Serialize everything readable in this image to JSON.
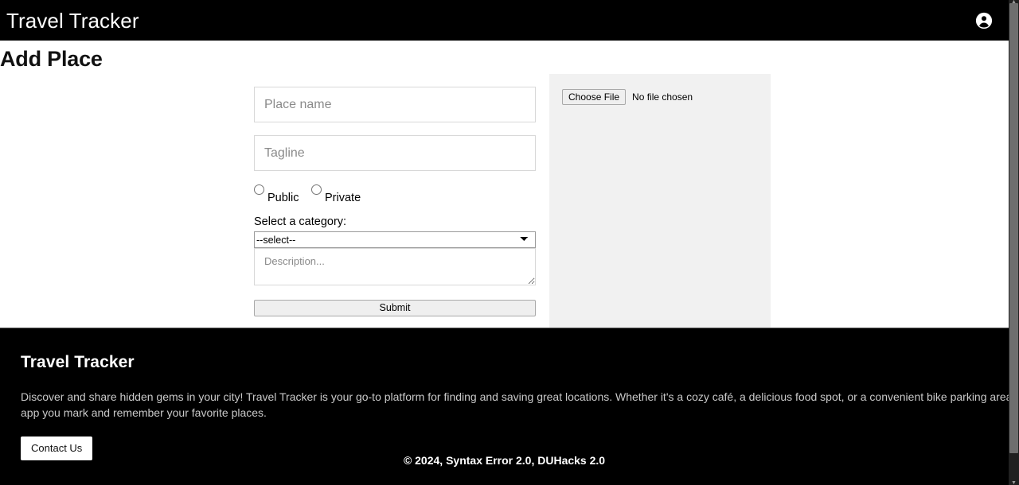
{
  "navbar": {
    "brand": "Travel Tracker",
    "account_icon": "account-circle-icon"
  },
  "page": {
    "title": "Add Place"
  },
  "form": {
    "place_name": {
      "placeholder": "Place name",
      "value": ""
    },
    "tagline": {
      "placeholder": "Tagline",
      "value": ""
    },
    "visibility": {
      "options": [
        {
          "label": "Public",
          "checked": false
        },
        {
          "label": "Private",
          "checked": false
        }
      ]
    },
    "category": {
      "label": "Select a category:",
      "selected": "--select--",
      "options": [
        "--select--"
      ]
    },
    "description": {
      "placeholder": "Description...",
      "value": ""
    },
    "submit_label": "Submit"
  },
  "upload": {
    "choose_file_label": "Choose File",
    "file_status": "No file chosen"
  },
  "footer": {
    "title": "Travel Tracker",
    "description": "Discover and share hidden gems in your city! Travel Tracker is your go-to platform for finding and saving great locations. Whether it's a cozy café, a delicious food spot, or a convenient bike parking area, this app you mark and remember your favorite places.",
    "contact_label": "Contact Us",
    "copyright": "© 2024, Syntax Error 2.0, DUHacks 2.0"
  },
  "colors": {
    "navbar_bg": "#000000",
    "footer_bg": "#000000",
    "panel_bg": "#f1f1f1",
    "page_bg": "#ffffff",
    "input_border": "#d8d8d8"
  }
}
